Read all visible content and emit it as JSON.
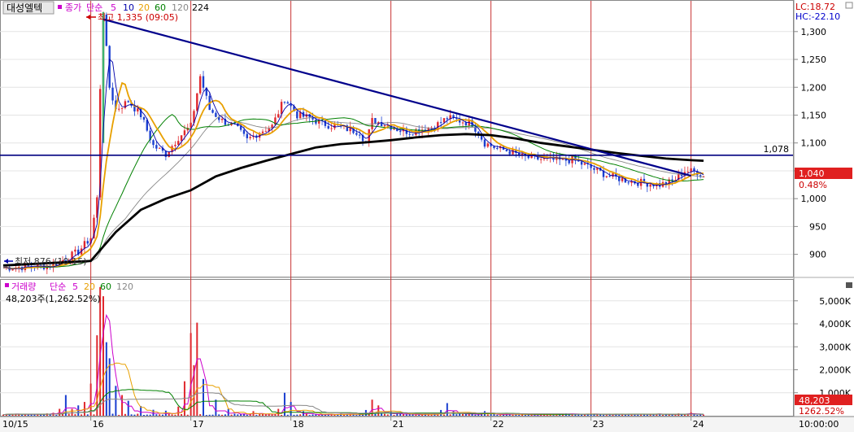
{
  "stock_name": "대성엘텍",
  "price_legend": {
    "label": "종가",
    "ma_type": "단순",
    "periods": [
      "5",
      "10",
      "20",
      "60",
      "120",
      "224"
    ],
    "colors": [
      "#cc00cc",
      "#0000aa",
      "#e8a000",
      "#008000",
      "#888888",
      "#000000"
    ]
  },
  "volume_legend": {
    "label": "거래량",
    "ma_type": "단순",
    "periods": [
      "5",
      "20",
      "60",
      "120"
    ],
    "colors": [
      "#cc00cc",
      "#e8a000",
      "#008000",
      "#888888"
    ]
  },
  "lc_label": "LC:18.72",
  "hc_label": "HC:-22.10",
  "high_annotation": "최고 1,335 (09:05)",
  "low_annotation": "최저 876 (10:15)",
  "hline_label": "1,078",
  "price_current": "1,040",
  "price_change": "0.48%",
  "volume_text": "48,203주(1,262.52%)",
  "volume_current": "48,203",
  "volume_change": "1262.52%",
  "time_label": "10:00:00",
  "chart_data": [
    {
      "type": "candlestick",
      "title": "대성엘텍",
      "x_ticks": [
        "10/15",
        "16",
        "17",
        "18",
        "21",
        "22",
        "23",
        "24"
      ],
      "y_ticks": [
        "900",
        "950",
        "1,000",
        "1,050",
        "1,100",
        "1,150",
        "1,200",
        "1,250",
        "1,300"
      ],
      "ylim": [
        860,
        1345
      ],
      "close_path": [
        [
          0,
          876
        ],
        [
          8,
          880
        ],
        [
          12,
          905
        ],
        [
          14,
          930
        ],
        [
          15,
          1000
        ],
        [
          15.5,
          1200
        ],
        [
          16,
          1335
        ],
        [
          17,
          1200
        ],
        [
          18,
          1160
        ],
        [
          20,
          1175
        ],
        [
          22,
          1150
        ],
        [
          24,
          1095
        ],
        [
          26,
          1080
        ],
        [
          28,
          1110
        ],
        [
          30,
          1130
        ],
        [
          31.5,
          1220
        ],
        [
          33,
          1160
        ],
        [
          35,
          1140
        ],
        [
          37,
          1130
        ],
        [
          39,
          1105
        ],
        [
          41,
          1120
        ],
        [
          43,
          1130
        ],
        [
          45,
          1180
        ],
        [
          47,
          1150
        ],
        [
          49,
          1145
        ],
        [
          51,
          1135
        ],
        [
          53,
          1130
        ],
        [
          55,
          1125
        ],
        [
          57,
          1120
        ],
        [
          58,
          1100
        ],
        [
          59,
          1140
        ],
        [
          61,
          1135
        ],
        [
          63,
          1125
        ],
        [
          65,
          1120
        ],
        [
          67,
          1125
        ],
        [
          69,
          1130
        ],
        [
          71,
          1145
        ],
        [
          73,
          1140
        ],
        [
          75,
          1135
        ],
        [
          77,
          1100
        ],
        [
          79,
          1090
        ],
        [
          81,
          1085
        ],
        [
          83,
          1075
        ],
        [
          85,
          1072
        ],
        [
          87,
          1070
        ],
        [
          89,
          1068
        ],
        [
          91,
          1070
        ],
        [
          93,
          1060
        ],
        [
          95,
          1050
        ],
        [
          97,
          1040
        ],
        [
          99,
          1035
        ],
        [
          101,
          1030
        ],
        [
          103,
          1028
        ],
        [
          105,
          1025
        ],
        [
          107,
          1030
        ],
        [
          109,
          1050
        ],
        [
          111,
          1048
        ],
        [
          112,
          1040
        ]
      ],
      "ma224_path": [
        [
          0,
          880
        ],
        [
          14,
          888
        ],
        [
          18,
          940
        ],
        [
          22,
          980
        ],
        [
          26,
          1000
        ],
        [
          30,
          1015
        ],
        [
          34,
          1040
        ],
        [
          38,
          1055
        ],
        [
          42,
          1068
        ],
        [
          46,
          1080
        ],
        [
          50,
          1092
        ],
        [
          54,
          1098
        ],
        [
          58,
          1101
        ],
        [
          62,
          1105
        ],
        [
          66,
          1110
        ],
        [
          70,
          1114
        ],
        [
          74,
          1116
        ],
        [
          78,
          1114
        ],
        [
          82,
          1108
        ],
        [
          86,
          1100
        ],
        [
          90,
          1094
        ],
        [
          94,
          1088
        ],
        [
          98,
          1082
        ],
        [
          102,
          1077
        ],
        [
          106,
          1072
        ],
        [
          110,
          1069
        ],
        [
          112,
          1068
        ]
      ],
      "trendline": [
        [
          16,
          1322
        ],
        [
          97,
          1080
        ]
      ],
      "horizontal_line": 1078
    },
    {
      "type": "bar",
      "title": "거래량",
      "y_ticks": [
        "1,000K",
        "2,000K",
        "3,000K",
        "4,000K",
        "5,000K"
      ],
      "ylim": [
        0,
        5700
      ],
      "spikes": [
        [
          7,
          100
        ],
        [
          8,
          130
        ],
        [
          9,
          300
        ],
        [
          10,
          900
        ],
        [
          11,
          300
        ],
        [
          12,
          450
        ],
        [
          13,
          600
        ],
        [
          14,
          1400
        ],
        [
          15,
          3500
        ],
        [
          15.5,
          5600
        ],
        [
          16,
          5200
        ],
        [
          16.5,
          3200
        ],
        [
          17,
          2500
        ],
        [
          18,
          1300
        ],
        [
          19,
          900
        ],
        [
          20,
          650
        ],
        [
          22,
          420
        ],
        [
          24,
          260
        ],
        [
          26,
          220
        ],
        [
          28,
          400
        ],
        [
          29,
          1500
        ],
        [
          30,
          3600
        ],
        [
          30.5,
          2200
        ],
        [
          31,
          4050
        ],
        [
          32,
          1600
        ],
        [
          34,
          700
        ],
        [
          36,
          300
        ],
        [
          40,
          200
        ],
        [
          44,
          300
        ],
        [
          45,
          1000
        ],
        [
          46,
          600
        ],
        [
          48,
          200
        ],
        [
          58,
          250
        ],
        [
          59,
          700
        ],
        [
          60,
          450
        ],
        [
          62,
          200
        ],
        [
          70,
          250
        ],
        [
          71,
          550
        ],
        [
          72,
          200
        ],
        [
          77,
          200
        ],
        [
          90,
          100
        ],
        [
          99,
          80
        ],
        [
          108,
          100
        ],
        [
          110,
          150
        ],
        [
          112,
          48
        ]
      ]
    }
  ]
}
